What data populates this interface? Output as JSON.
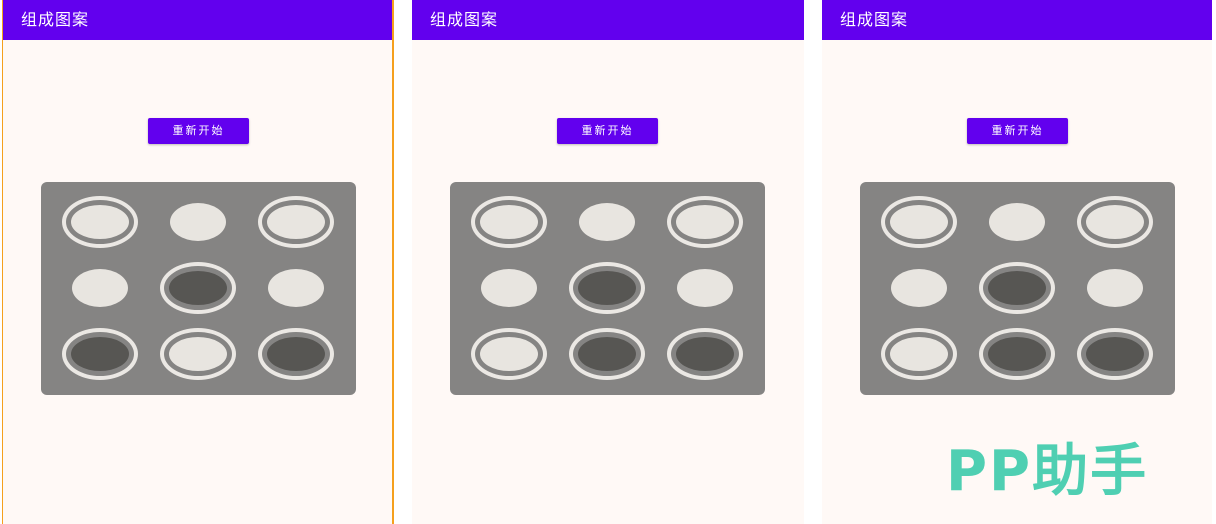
{
  "screens": [
    {
      "app_title": "组成图案",
      "restart_label": "重新开始",
      "grid": [
        [
          "ringed-light",
          "plain",
          "ringed-light"
        ],
        [
          "plain",
          "ringed-dark",
          "plain"
        ],
        [
          "ringed-dark",
          "ringed-light",
          "ringed-dark"
        ]
      ]
    },
    {
      "app_title": "组成图案",
      "restart_label": "重新开始",
      "grid": [
        [
          "ringed-light",
          "plain",
          "ringed-light"
        ],
        [
          "plain",
          "ringed-dark",
          "plain"
        ],
        [
          "ringed-light",
          "ringed-dark",
          "ringed-dark"
        ]
      ]
    },
    {
      "app_title": "组成图案",
      "restart_label": "重新开始",
      "grid": [
        [
          "ringed-light",
          "plain",
          "ringed-light"
        ],
        [
          "plain",
          "ringed-dark",
          "plain"
        ],
        [
          "ringed-light",
          "ringed-dark",
          "ringed-dark"
        ]
      ]
    }
  ],
  "watermark": "PP助手",
  "colors": {
    "app_bar": "#6200ee",
    "board": "#858483",
    "light_cell": "#e8e5e0",
    "dark_cell": "#575653",
    "watermark": "#4fcfb2"
  }
}
